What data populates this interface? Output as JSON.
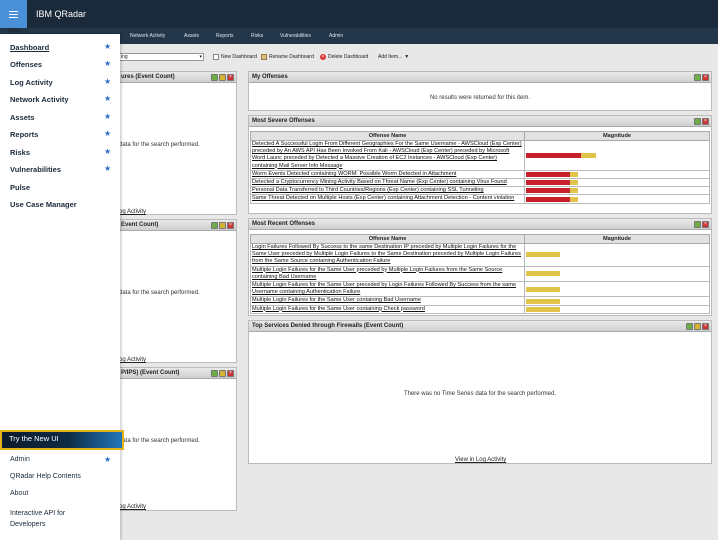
{
  "app": {
    "brand": "IBM QRadar",
    "menu_caption": "Menu"
  },
  "nav": {
    "tabs": [
      "Network Activity",
      "Assets",
      "Reports",
      "Risks",
      "Vulnerabilities",
      "Admin"
    ]
  },
  "toolbar": {
    "dashboard_select_value": "ing",
    "new_dashboard": "New Dashboard",
    "rename_dashboard": "Rename Dashboard",
    "delete_dashboard": "Delete Dashboard",
    "add_item": "Add Item...",
    "add_item_arrow": "▼"
  },
  "left_panels": {
    "p1_title": "ures (Event Count)",
    "p1_msg": "data for the search performed.",
    "p1_link": "og Activity",
    "p2_title": "Event Count)",
    "p2_msg": "data for the search performed.",
    "p2_link": "og Activity",
    "p3_title": "P/IPS) (Event Count)",
    "p3_msg": "data for the search performed.",
    "p3_link": "og Activity"
  },
  "my_offenses": {
    "title": "My Offenses",
    "message": "No results were returned for this item."
  },
  "most_severe": {
    "title": "Most Severe Offenses",
    "col_name": "Offense Name",
    "col_mag": "Magnitude",
    "rows": [
      {
        "name": "Detected A Successful Login From Different Geographies For the Same Username - AWSCloud (Exp Center) preceded by An AWS API Has Been Invoked From Kali - AWSCloud (Exp Center) preceded by Microsoft Word Launc preceded by Detected a Massive Creation of EC2 Instances - AWSCloud (Exp Center) containing Mail Server Info Message",
        "red": 0.78,
        "yellow": 0.22
      },
      {
        "name": "Worm Events Detected containing WORM: Possible Worm Detected in Attachment",
        "red": 0.63,
        "yellow": 0.11
      },
      {
        "name": "Detected a Cryptocurrency Mining Activity Based on Threat Name (Exp Center) containing Virus Found",
        "red": 0.63,
        "yellow": 0.11
      },
      {
        "name": "Personal Data Transferred to Third Countries/Regions (Exp Center) containing SSL Tunneling",
        "red": 0.63,
        "yellow": 0.11
      },
      {
        "name": "Same Threat Detected on Multiple Hosts (Exp Center) containing Attachment Detection - Content violation",
        "red": 0.63,
        "yellow": 0.11
      }
    ]
  },
  "most_recent": {
    "title": "Most Recent Offenses",
    "col_name": "Offense Name",
    "col_mag": "Magnitude",
    "rows": [
      {
        "name": "Login Failures Followed By Success to the same Destination IP preceded by Multiple Login Failures for the Same User preceded by Multiple Login Failures to the Same Destination preceded by Multiple Login Failures from the Same Source containing Authentication Failure",
        "red": 0.0,
        "yellow": 0.48
      },
      {
        "name": "Multiple Login Failures for the Same User preceded by Multiple Login Failures from the Same Source containing Bad Username",
        "red": 0.0,
        "yellow": 0.48
      },
      {
        "name": "Multiple Login Failures for the Same User preceded by Login Failures Followed By Success from the same Username containing Authentication Failure",
        "red": 0.0,
        "yellow": 0.48
      },
      {
        "name": "Multiple Login Failures for the Same User containing Bad Username",
        "red": 0.0,
        "yellow": 0.48
      },
      {
        "name": "Multiple Login Failures for the Same User containing Check password",
        "red": 0.0,
        "yellow": 0.48
      }
    ]
  },
  "top_services": {
    "title": "Top Services Denied through Firewalls (Event Count)",
    "message": "There was no Time Series data for the search performed.",
    "link": "View in Log Activity"
  },
  "menu": {
    "items": [
      {
        "label": "Dashboard",
        "starred": true,
        "active": true
      },
      {
        "label": "Offenses",
        "starred": true
      },
      {
        "label": "Log Activity",
        "starred": true
      },
      {
        "label": "Network Activity",
        "starred": true
      },
      {
        "label": "Assets",
        "starred": true
      },
      {
        "label": "Reports",
        "starred": true
      },
      {
        "label": "Risks",
        "starred": true
      },
      {
        "label": "Vulnerabilities",
        "starred": true
      },
      {
        "label": "Pulse",
        "starred": false
      },
      {
        "label": "Use Case Manager",
        "starred": false
      }
    ],
    "star_glyph": "★",
    "try_new": "Try the New UI",
    "admin": "Admin",
    "help": "QRadar Help Contents",
    "about": "About",
    "api": "Interactive API for Developers"
  },
  "colors": {
    "header": "#1b2a3a",
    "menu_button": "#4a90d9",
    "highlight": "#e2b21a",
    "star": "#2c6fc4",
    "magnitude_red": "#c8202a",
    "magnitude_yellow": "#e2c34a"
  }
}
